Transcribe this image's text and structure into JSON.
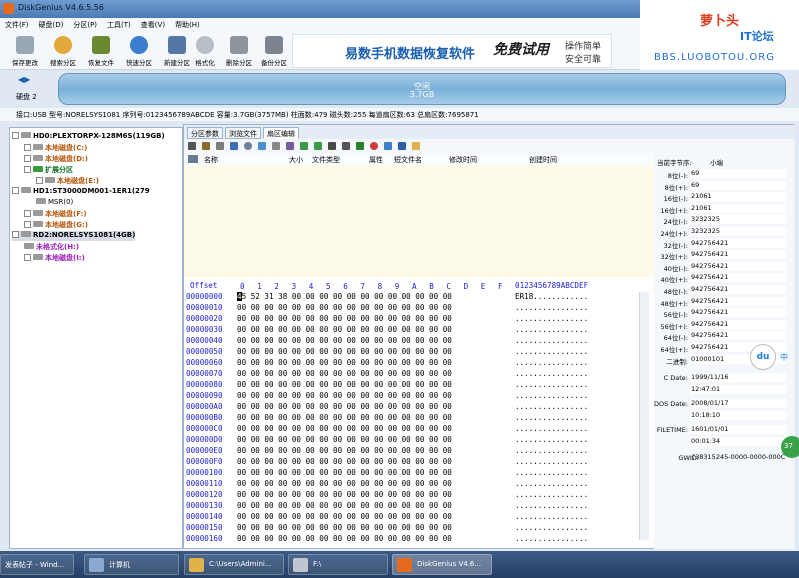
{
  "window": {
    "title": "DiskGenius V4.6.5.56"
  },
  "menu": [
    "文件(F)",
    "硬盘(D)",
    "分区(P)",
    "工具(T)",
    "查看(V)",
    "帮助(H)"
  ],
  "toolbar": [
    "保存更改",
    "搜索分区",
    "恢复文件",
    "快速分区",
    "新建分区",
    "格式化",
    "删除分区",
    "备份分区"
  ],
  "banner": {
    "text": "易数手机数据恢复软件",
    "free": "免费试用",
    "slogan1": "操作简单",
    "slogan2": "安全可靠"
  },
  "logo": {
    "name": "萝卜头",
    "sub": "IT论坛",
    "url": "BBS.LUOBOTOU.ORG"
  },
  "disk": {
    "label": "硬盘 2",
    "part_name": "空闲",
    "part_size": "3.7GB"
  },
  "info": {
    "text": "接口:USB  型号:NORELSYS1081  序列号:0123456789ABCDE  容量:3.7GB(3757MB)  柱面数:479  磁头数:255  每道扇区数:63  总扇区数:7695871"
  },
  "tree": [
    {
      "text": "HD0:PLEXTORPX-128M6S(119GB)"
    },
    {
      "text": "本地磁盘(C:)"
    },
    {
      "text": "本地磁盘(D:)"
    },
    {
      "text": "扩展分区"
    },
    {
      "text": "本地磁盘(E:)"
    },
    {
      "text": "HD1:ST3000DM001-1ER1(279"
    },
    {
      "text": "MSR(0)"
    },
    {
      "text": "本地磁盘(F:)"
    },
    {
      "text": "本地磁盘(G:)"
    },
    {
      "text": "RD2:NORELSYS1081(4GB)"
    },
    {
      "text": "未格式化(H:)"
    },
    {
      "text": "本地磁盘(I:)"
    }
  ],
  "tabs": [
    "分区参数",
    "浏览文件",
    "扇区编辑"
  ],
  "file_headers": [
    "名称",
    "大小",
    "文件类型",
    "属性",
    "短文件名",
    "修改时间",
    "创建时间"
  ],
  "hex": {
    "header_offset": "Offset",
    "header_cols": [
      "0",
      "1",
      "2",
      "3",
      "4",
      "5",
      "6",
      "7",
      "8",
      "9",
      "A",
      "B",
      "C",
      "D",
      "E",
      "F"
    ],
    "header_ascii": "0123456789ABCDEF",
    "rows": [
      {
        "off": "00000000",
        "hex": "5 52 31 38 00 00 00 00 00 00 00 00 00 00 00 00",
        "first": "4",
        "asc": "ER18............"
      },
      {
        "off": "00000010",
        "hex": "00 00 00 00 00 00 00 00 00 00 00 00 00 00 00 00",
        "asc": "................"
      },
      {
        "off": "00000020",
        "hex": "00 00 00 00 00 00 00 00 00 00 00 00 00 00 00 00",
        "asc": "................"
      },
      {
        "off": "00000030",
        "hex": "00 00 00 00 00 00 00 00 00 00 00 00 00 00 00 00",
        "asc": "................"
      },
      {
        "off": "00000040",
        "hex": "00 00 00 00 00 00 00 00 00 00 00 00 00 00 00 00",
        "asc": "................"
      },
      {
        "off": "00000050",
        "hex": "00 00 00 00 00 00 00 00 00 00 00 00 00 00 00 00",
        "asc": "................"
      },
      {
        "off": "00000060",
        "hex": "00 00 00 00 00 00 00 00 00 00 00 00 00 00 00 00",
        "asc": "................"
      },
      {
        "off": "00000070",
        "hex": "00 00 00 00 00 00 00 00 00 00 00 00 00 00 00 00",
        "asc": "................"
      },
      {
        "off": "00000080",
        "hex": "00 00 00 00 00 00 00 00 00 00 00 00 00 00 00 00",
        "asc": "................"
      },
      {
        "off": "00000090",
        "hex": "00 00 00 00 00 00 00 00 00 00 00 00 00 00 00 00",
        "asc": "................"
      },
      {
        "off": "000000A0",
        "hex": "00 00 00 00 00 00 00 00 00 00 00 00 00 00 00 00",
        "asc": "................"
      },
      {
        "off": "000000B0",
        "hex": "00 00 00 00 00 00 00 00 00 00 00 00 00 00 00 00",
        "asc": "................"
      },
      {
        "off": "000000C0",
        "hex": "00 00 00 00 00 00 00 00 00 00 00 00 00 00 00 00",
        "asc": "................"
      },
      {
        "off": "000000D0",
        "hex": "00 00 00 00 00 00 00 00 00 00 00 00 00 00 00 00",
        "asc": "................"
      },
      {
        "off": "000000E0",
        "hex": "00 00 00 00 00 00 00 00 00 00 00 00 00 00 00 00",
        "asc": "................"
      },
      {
        "off": "000000F0",
        "hex": "00 00 00 00 00 00 00 00 00 00 00 00 00 00 00 00",
        "asc": "................"
      },
      {
        "off": "00000100",
        "hex": "00 00 00 00 00 00 00 00 00 00 00 00 00 00 00 00",
        "asc": "................"
      },
      {
        "off": "00000110",
        "hex": "00 00 00 00 00 00 00 00 00 00 00 00 00 00 00 00",
        "asc": "................"
      },
      {
        "off": "00000120",
        "hex": "00 00 00 00 00 00 00 00 00 00 00 00 00 00 00 00",
        "asc": "................"
      },
      {
        "off": "00000130",
        "hex": "00 00 00 00 00 00 00 00 00 00 00 00 00 00 00 00",
        "asc": "................"
      },
      {
        "off": "00000140",
        "hex": "00 00 00 00 00 00 00 00 00 00 00 00 00 00 00 00",
        "asc": "................"
      },
      {
        "off": "00000150",
        "hex": "00 00 00 00 00 00 00 00 00 00 00 00 00 00 00 00",
        "asc": "................"
      },
      {
        "off": "00000160",
        "hex": "00 00 00 00 00 00 00 00 00 00 00 00 00 00 00 00",
        "asc": "................"
      }
    ]
  },
  "props": {
    "byte_order_label": "当前字节序:",
    "byte_order": "小端",
    "rows": [
      {
        "k": "8位(-):",
        "v": "69"
      },
      {
        "k": "8位(+):",
        "v": "69"
      },
      {
        "k": "16位(-):",
        "v": "21061"
      },
      {
        "k": "16位(+):",
        "v": "21061"
      },
      {
        "k": "24位(-):",
        "v": "3232325"
      },
      {
        "k": "24位(+):",
        "v": "3232325"
      },
      {
        "k": "32位(-):",
        "v": "942756421"
      },
      {
        "k": "32位(+):",
        "v": "942756421"
      },
      {
        "k": "40位(-):",
        "v": "942756421"
      },
      {
        "k": "40位(+):",
        "v": "942756421"
      },
      {
        "k": "48位(-):",
        "v": "942756421"
      },
      {
        "k": "48位(+):",
        "v": "942756421"
      },
      {
        "k": "56位(-):",
        "v": "942756421"
      },
      {
        "k": "56位(+):",
        "v": "942756421"
      },
      {
        "k": "64位(-):",
        "v": "942756421"
      },
      {
        "k": "64位(+):",
        "v": "942756421"
      },
      {
        "k": "二进制:",
        "v": "01000101"
      }
    ],
    "cdate_label": "C Date:",
    "cdate": "1999/11/16",
    "ctime": "12:47:01",
    "dosdate_label": "DOS Date:",
    "dosdate": "2008/01/17",
    "dostime": "10:18:10",
    "filetime_label": "FILETIME:",
    "filetime": "1601/01/01",
    "filetime_t": "00:01:34",
    "guid_label": "GWID:",
    "guid": "{38315245-0000-0000-000C"
  },
  "overlay": {
    "du": "du",
    "zh": "中",
    "badge": "37"
  },
  "taskbar": [
    "发表帖子 - Wind...",
    "计算机",
    "C:\\Users\\Admini...",
    "F:\\",
    "DiskGenius V4.6..."
  ]
}
